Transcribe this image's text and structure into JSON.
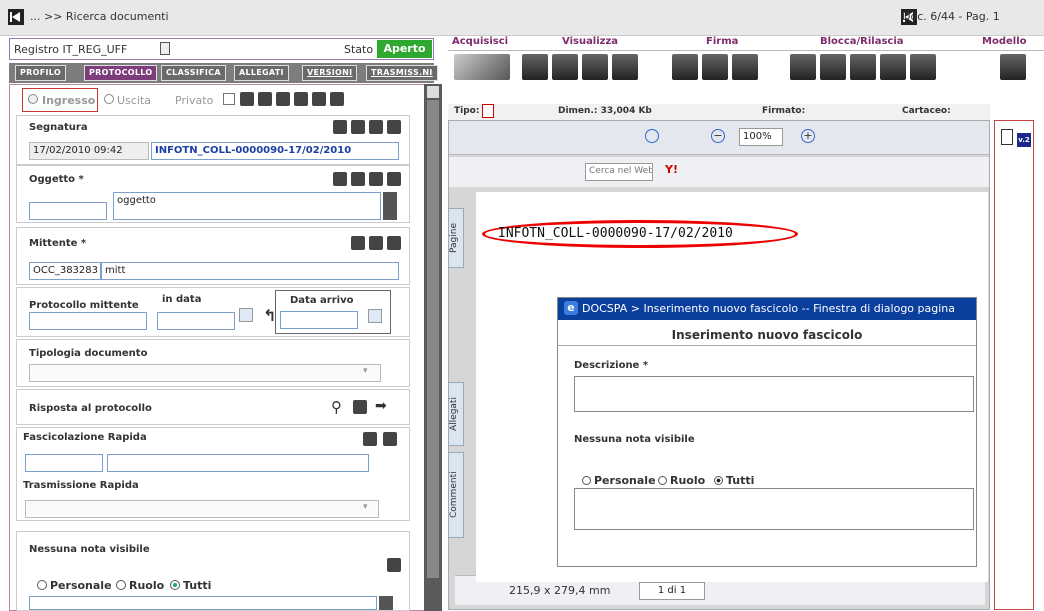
{
  "top": {
    "breadcrumb": "... >> Ricerca documenti",
    "docinfo": "Doc. 6/44 - Pag. 1"
  },
  "reg": {
    "label": "Registro IT_REG_UFF",
    "stato_label": "Stato",
    "stato_value": "Aperto"
  },
  "tabs": [
    "PROFILO",
    "PROTOCOLLO",
    "CLASSIFICA",
    "ALLEGATI",
    "VERSIONI",
    "TRASMISS.NI"
  ],
  "radio": {
    "ingresso": "Ingresso",
    "uscita": "Uscita",
    "privato": "Privato"
  },
  "segnatura": {
    "label": "Segnatura",
    "date": "17/02/2010 09:42",
    "code": "INFOTN_COLL-0000090-17/02/2010"
  },
  "oggetto": {
    "label": "Oggetto *",
    "value": "oggetto"
  },
  "mittente": {
    "label": "Mittente *",
    "code": "OCC_383283",
    "value": "mitt"
  },
  "protocollo": {
    "label": "Protocollo mittente",
    "indata": "in data",
    "arrivo": "Data arrivo"
  },
  "tipologia": {
    "label": "Tipologia documento"
  },
  "risposta": {
    "label": "Risposta al protocollo"
  },
  "fasc": {
    "label": "Fascicolazione Rapida"
  },
  "trasm": {
    "label": "Trasmissione Rapida"
  },
  "note": {
    "label": "Nessuna nota visibile",
    "personale": "Personale",
    "ruolo": "Ruolo",
    "tutti": "Tutti"
  },
  "ribbon": {
    "acquisisci": "Acquisisci",
    "visualizza": "Visualizza",
    "firma": "Firma",
    "blocca": "Blocca/Rilascia",
    "modello": "Modello"
  },
  "info": {
    "tipo": "Tipo:",
    "dimen": "Dimen.: 33,004 Kb",
    "firmato": "Firmato:",
    "cartaceo": "Cartaceo:"
  },
  "viewer": {
    "zoom": "100%",
    "search": "Cerca nel Web",
    "pagine": "Pagine",
    "allegati": "Allegati",
    "commenti": "Commenti",
    "docline": "INFOTN_COLL-0000090-17/02/2010",
    "size": "215,9 x 279,4 mm",
    "page": "1 di 1"
  },
  "dialog": {
    "title": "DOCSPA > Inserimento nuovo fascicolo -- Finestra di dialogo pagina",
    "header": "Inserimento nuovo fascicolo",
    "descr": "Descrizione *",
    "nota": "Nessuna nota visibile",
    "personale": "Personale",
    "ruolo": "Ruolo",
    "tutti": "Tutti"
  },
  "version": "v.2"
}
